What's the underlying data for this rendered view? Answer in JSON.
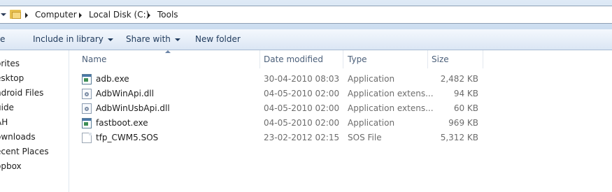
{
  "address": {
    "breadcrumbs": [
      "Computer",
      "Local Disk (C:)",
      "Tools"
    ]
  },
  "toolbar": {
    "organize_label": "e",
    "include_label": "Include in library",
    "share_label": "Share with",
    "newfolder_label": "New folder"
  },
  "nav": {
    "items": [
      "orites",
      "esktop",
      "ndroid Files",
      "uide",
      "AH",
      "ownloads",
      "ecent Places",
      "opbox"
    ]
  },
  "columns": {
    "name": "Name",
    "date": "Date modified",
    "type": "Type",
    "size": "Size"
  },
  "files": [
    {
      "name": "adb.exe",
      "date": "30-04-2010 08:03",
      "type": "Application",
      "size": "2,482 KB",
      "icon": "exe-icon"
    },
    {
      "name": "AdbWinApi.dll",
      "date": "04-05-2010 02:00",
      "type": "Application extens...",
      "size": "94 KB",
      "icon": "dll-icon"
    },
    {
      "name": "AdbWinUsbApi.dll",
      "date": "04-05-2010 02:00",
      "type": "Application extens...",
      "size": "60 KB",
      "icon": "dll-icon"
    },
    {
      "name": "fastboot.exe",
      "date": "04-05-2010 02:00",
      "type": "Application",
      "size": "969 KB",
      "icon": "exe-icon"
    },
    {
      "name": "tfp_CWM5.SOS",
      "date": "23-02-2012 02:15",
      "type": "SOS File",
      "size": "5,312 KB",
      "icon": "file-icon"
    }
  ]
}
